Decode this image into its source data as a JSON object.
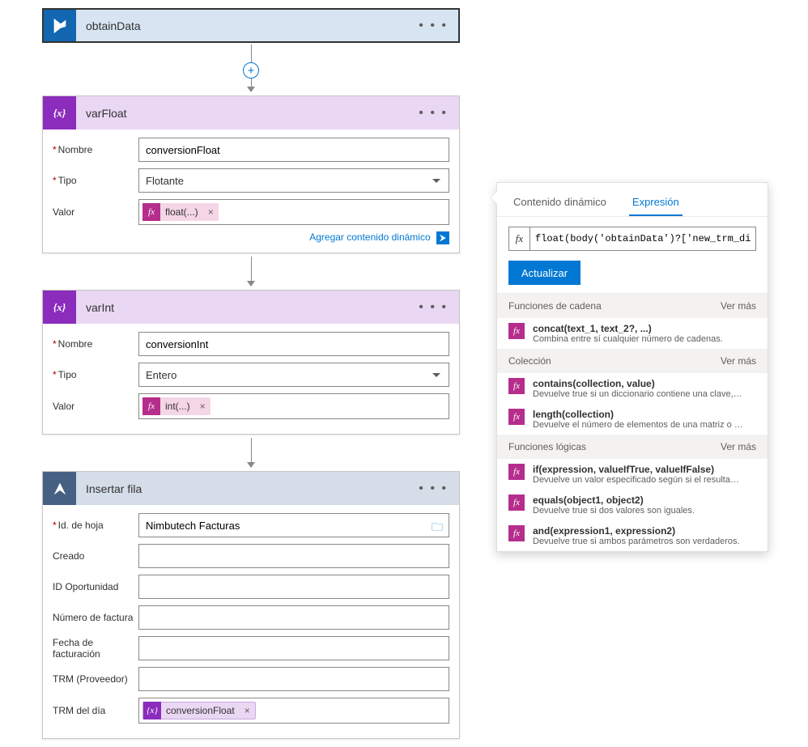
{
  "actions": {
    "obtainData": {
      "title": "obtainData"
    },
    "varFloat": {
      "title": "varFloat",
      "name_label": "Nombre",
      "name_value": "conversionFloat",
      "type_label": "Tipo",
      "type_value": "Flotante",
      "value_label": "Valor",
      "token_label": "float(...)",
      "dyn_link": "Agregar contenido dinámico"
    },
    "varInt": {
      "title": "varInt",
      "name_label": "Nombre",
      "name_value": "conversionInt",
      "type_label": "Tipo",
      "type_value": "Entero",
      "value_label": "Valor",
      "token_label": "int(...)"
    },
    "insert": {
      "title": "Insertar fila",
      "fields": {
        "sheetId": {
          "label": "Id. de hoja",
          "value": "Nimbutech Facturas",
          "required": true
        },
        "created": {
          "label": "Creado"
        },
        "oppId": {
          "label": "ID Oportunidad"
        },
        "invoiceNo": {
          "label": "Número de factura"
        },
        "invoiceDate": {
          "label": "Fecha de facturación"
        },
        "trmProv": {
          "label": "TRM (Proveedor)"
        },
        "trmDay": {
          "label": "TRM del día",
          "token_label": "conversionFloat"
        }
      }
    }
  },
  "flyout": {
    "tabs": {
      "dynamic": "Contenido dinámico",
      "expression": "Expresión"
    },
    "expression_value": "float(body('obtainData')?['new_trm_dia'])",
    "update": "Actualizar",
    "see_more": "Ver más",
    "sections": [
      {
        "title": "Funciones de cadena",
        "items": [
          {
            "title": "concat(text_1, text_2?, ...)",
            "desc": "Combina entre sí cualquier número de cadenas."
          }
        ]
      },
      {
        "title": "Colección",
        "items": [
          {
            "title": "contains(collection, value)",
            "desc": "Devuelve true si un diccionario contiene una clave, una m..."
          },
          {
            "title": "length(collection)",
            "desc": "Devuelve el número de elementos de una matriz o cadena."
          }
        ]
      },
      {
        "title": "Funciones lógicas",
        "items": [
          {
            "title": "if(expression, valueIfTrue, valueIfFalse)",
            "desc": "Devuelve un valor especificado según si el resultado de la..."
          },
          {
            "title": "equals(object1, object2)",
            "desc": "Devuelve true si dos valores son iguales."
          },
          {
            "title": "and(expression1, expression2)",
            "desc": "Devuelve true si ambos parámetros son verdaderos."
          }
        ]
      }
    ]
  },
  "glyphs": {
    "fx": "fx",
    "var": "{x}",
    "plus": "+",
    "close": "×",
    "dots": "• • •",
    "folder": "🗀"
  }
}
